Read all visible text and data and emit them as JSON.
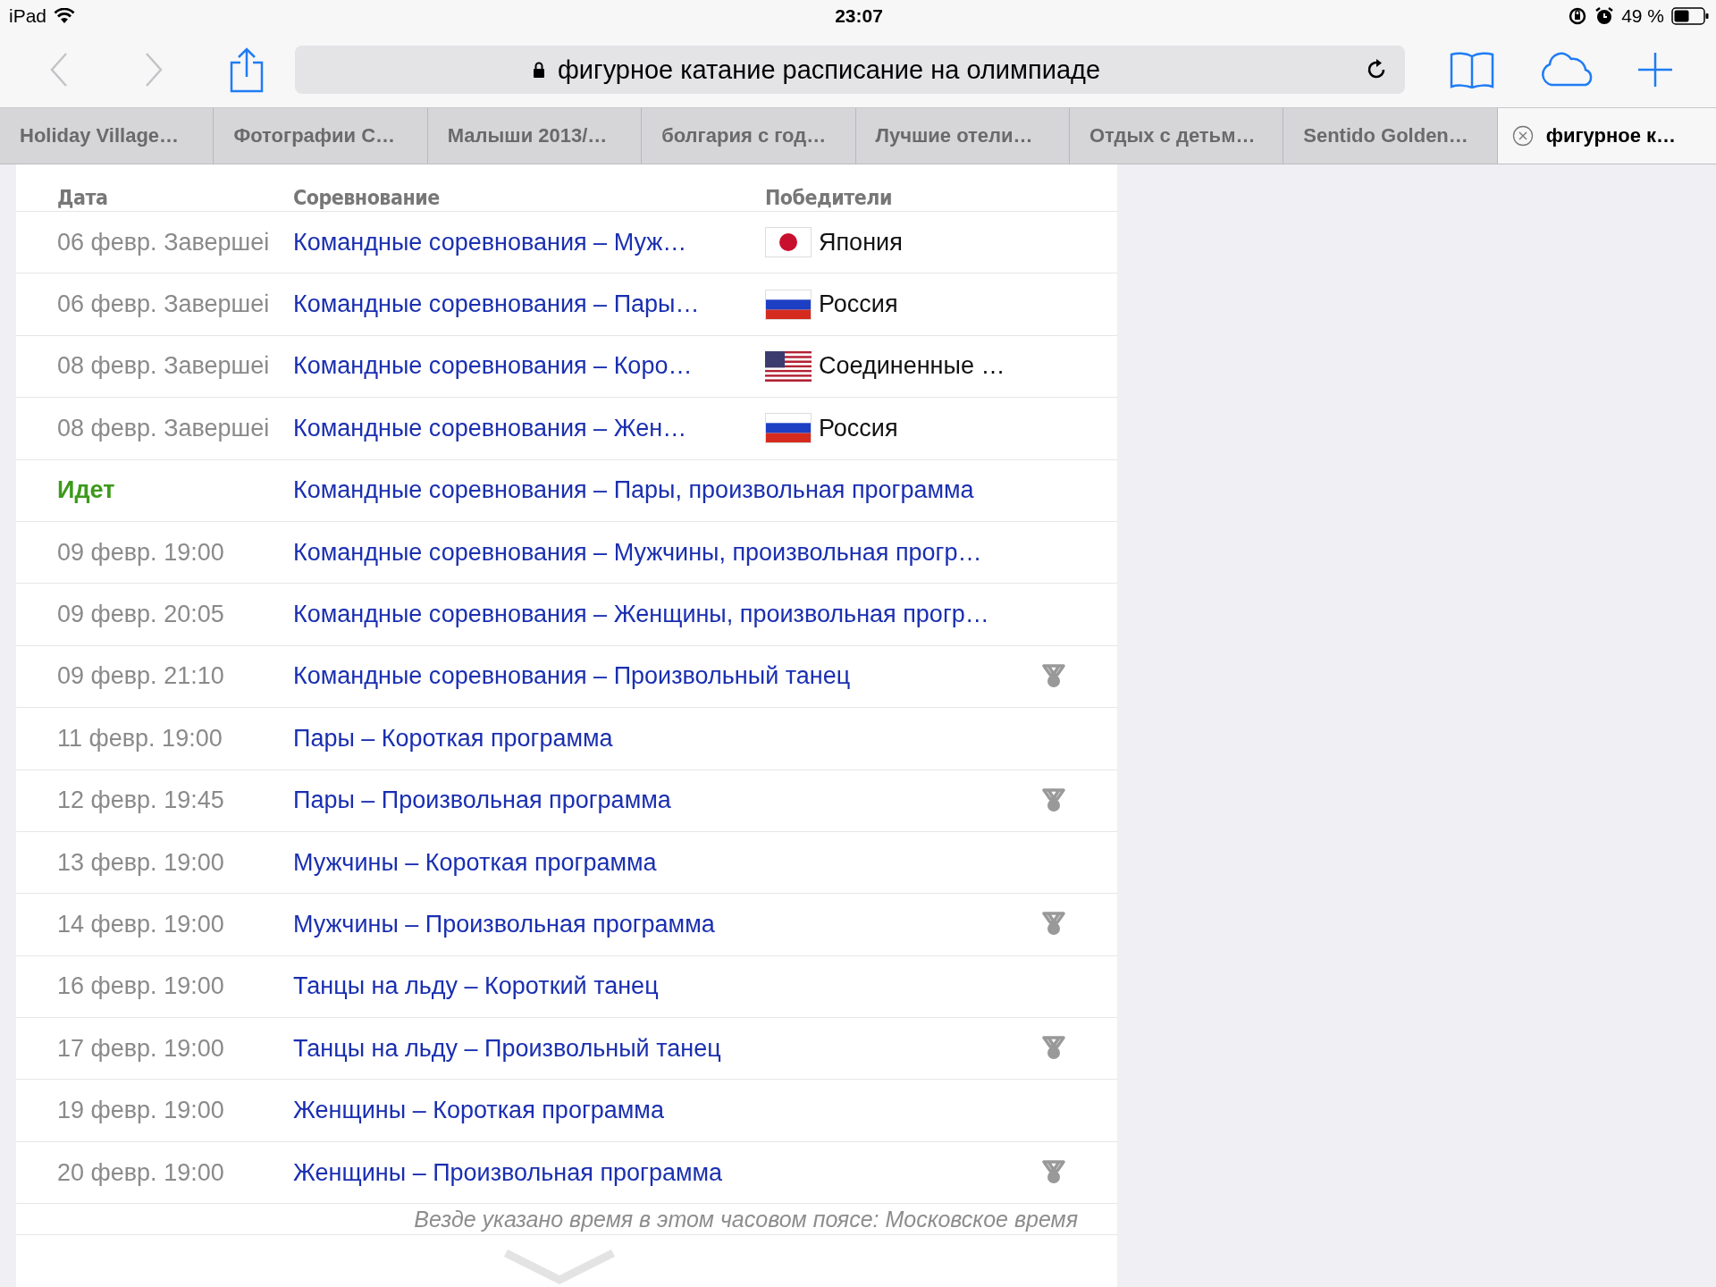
{
  "status_bar": {
    "device": "iPad",
    "time": "23:07",
    "battery": "49 %"
  },
  "toolbar": {
    "back_disabled": true,
    "forward_disabled": true,
    "url": "фигурное катание расписание на олимпиаде",
    "secure": true
  },
  "tabs": [
    {
      "label": "Holiday Village…",
      "selected": false
    },
    {
      "label": "Фотографии С…",
      "selected": false
    },
    {
      "label": "Малыши 2013/…",
      "selected": false
    },
    {
      "label": "болгария с год…",
      "selected": false
    },
    {
      "label": "Лучшие отели…",
      "selected": false
    },
    {
      "label": "Отдых с детьм…",
      "selected": false
    },
    {
      "label": "Sentido Golden…",
      "selected": false
    },
    {
      "label": "фигурное к…",
      "selected": true
    }
  ],
  "table": {
    "columns": [
      "Дата",
      "Соревнование",
      "Победители"
    ],
    "rows": [
      {
        "date": "06 февр. Завершеі",
        "live": false,
        "event": "Командные соревнования – Муж…",
        "winner": {
          "kind": "japan",
          "country": "Япония"
        },
        "medal": false
      },
      {
        "date": "06 февр. Завершеі",
        "live": false,
        "event": "Командные соревнования – Пары…",
        "winner": {
          "kind": "russia",
          "country": "Россия"
        },
        "medal": false
      },
      {
        "date": "08 февр. Завершеі",
        "live": false,
        "event": "Командные соревнования – Коро…",
        "winner": {
          "kind": "usa",
          "country": "Соединенные …"
        },
        "medal": false
      },
      {
        "date": "08 февр. Завершеі",
        "live": false,
        "event": "Командные соревнования – Жен…",
        "winner": {
          "kind": "russia",
          "country": "Россия"
        },
        "medal": false
      },
      {
        "date": "Идет",
        "live": true,
        "event": "Командные соревнования – Пары, произвольная программа",
        "medal": false
      },
      {
        "date": "09 февр. 19:00",
        "live": false,
        "event": "Командные соревнования – Мужчины, произвольная прогр…",
        "medal": false
      },
      {
        "date": "09 февр. 20:05",
        "live": false,
        "event": "Командные соревнования – Женщины, произвольная прогр…",
        "medal": false
      },
      {
        "date": "09 февр. 21:10",
        "live": false,
        "event": "Командные соревнования – Произвольный танец",
        "medal": true
      },
      {
        "date": "11 февр. 19:00",
        "live": false,
        "event": "Пары – Короткая программа",
        "medal": false
      },
      {
        "date": "12 февр. 19:45",
        "live": false,
        "event": "Пары – Произвольная программа",
        "medal": true
      },
      {
        "date": "13 февр. 19:00",
        "live": false,
        "event": "Мужчины – Короткая программа",
        "medal": false
      },
      {
        "date": "14 февр. 19:00",
        "live": false,
        "event": "Мужчины – Произвольная программа",
        "medal": true
      },
      {
        "date": "16 февр. 19:00",
        "live": false,
        "event": "Танцы на льду – Короткий танец",
        "medal": false
      },
      {
        "date": "17 февр. 19:00",
        "live": false,
        "event": "Танцы на льду – Произвольный танец",
        "medal": true
      },
      {
        "date": "19 февр. 19:00",
        "live": false,
        "event": "Женщины – Короткая программа",
        "medal": false
      },
      {
        "date": "20 февр. 19:00",
        "live": false,
        "event": "Женщины – Произвольная программа",
        "medal": true
      }
    ],
    "footnote": "Везде указано время в этом часовом поясе: Московское время"
  }
}
